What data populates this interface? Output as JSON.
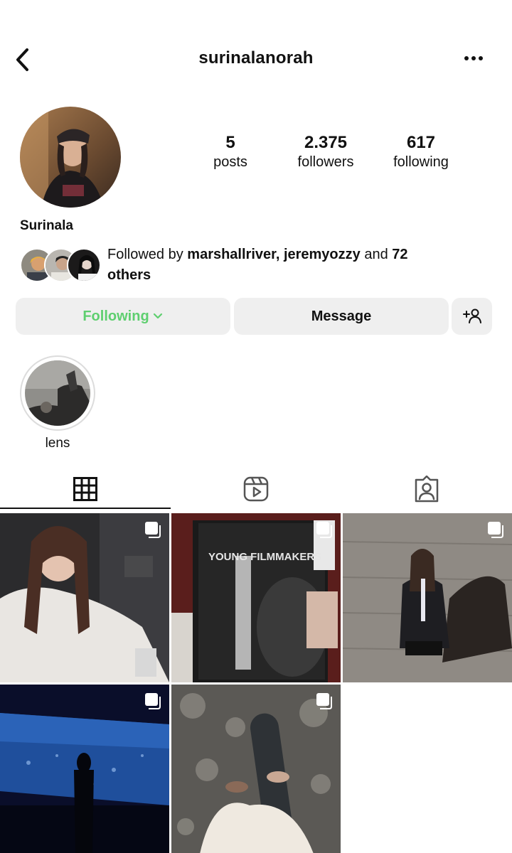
{
  "header": {
    "username": "surinalanorah"
  },
  "profile": {
    "display_name": "Surinala",
    "stats": [
      {
        "number": "5",
        "label": "posts"
      },
      {
        "number": "2.375",
        "label": "followers"
      },
      {
        "number": "617",
        "label": "following"
      }
    ],
    "followed_by": {
      "prefix": "Followed by ",
      "user1": "marshallriver",
      "separator": ", ",
      "user2": "jeremyozzy",
      "middle": " and ",
      "count": "72",
      "suffix": " others"
    }
  },
  "actions": {
    "following_label": "Following",
    "message_label": "Message"
  },
  "highlights": [
    {
      "label": "lens"
    }
  ],
  "tabs": [
    {
      "icon": "grid-icon"
    },
    {
      "icon": "reels-icon"
    },
    {
      "icon": "tagged-icon"
    }
  ],
  "colors": {
    "following_green": "#5ecf6f",
    "button_bg": "#efefef"
  }
}
